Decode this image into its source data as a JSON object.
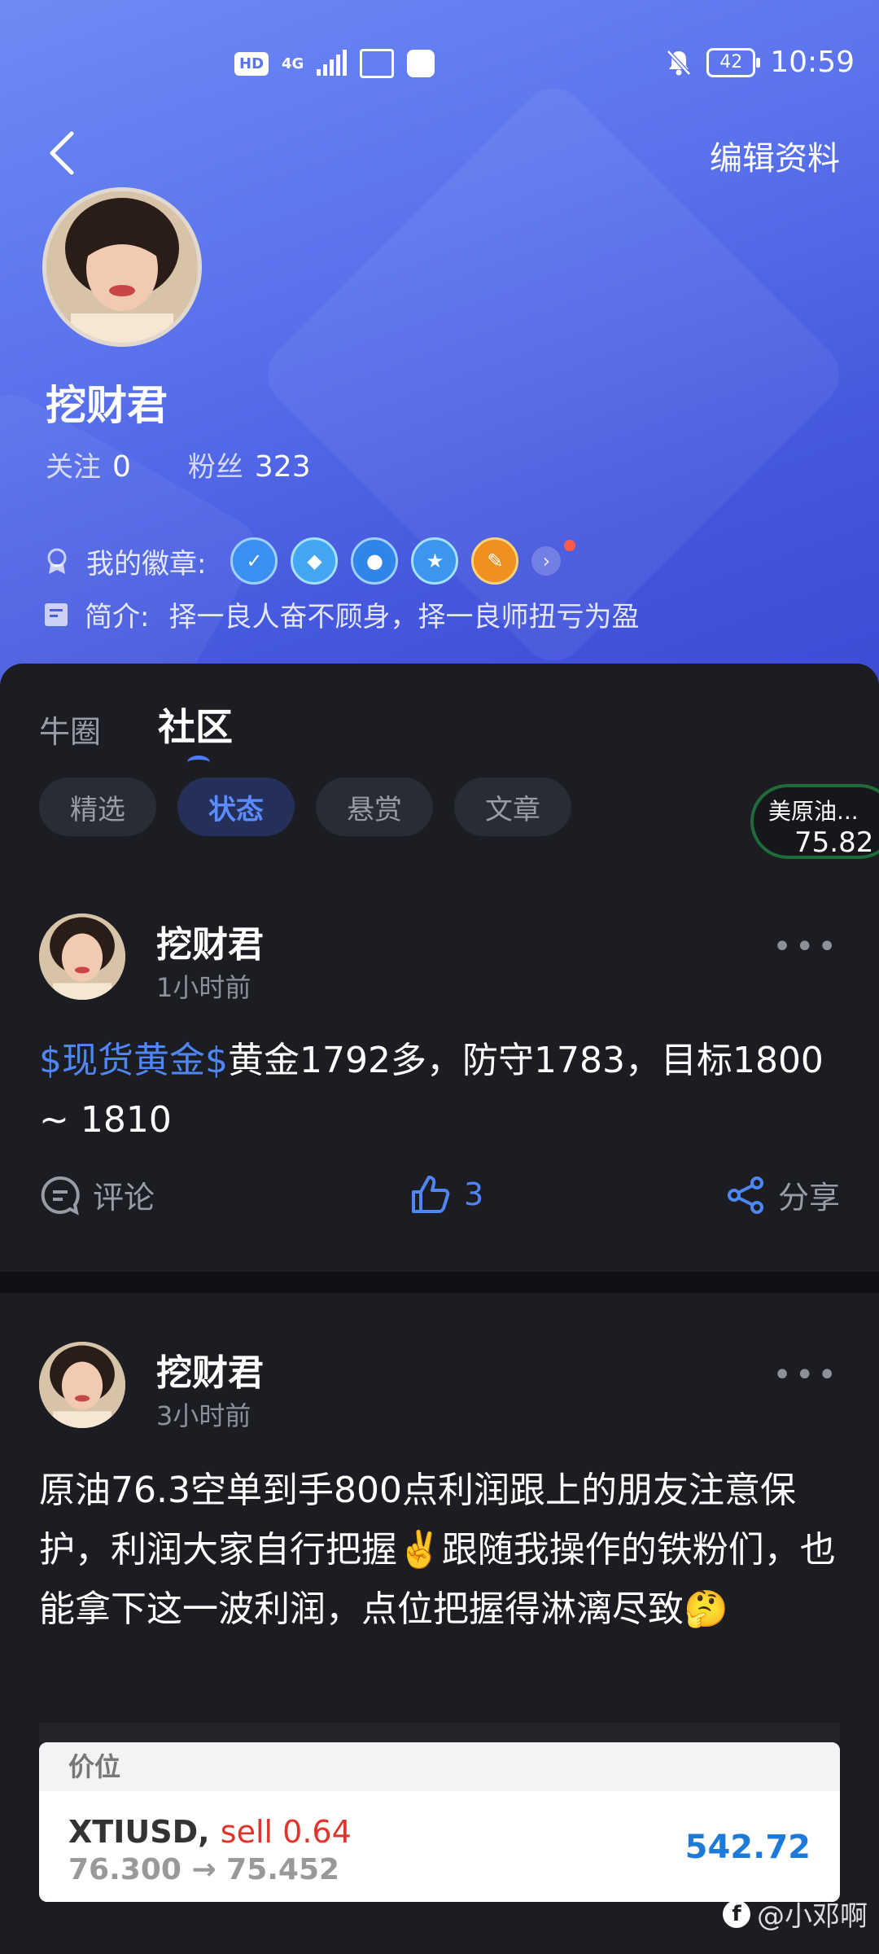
{
  "status_bar": {
    "time": "10:59",
    "battery": "42",
    "network": "4G",
    "hd": "HD"
  },
  "header": {
    "back_icon": "chevron-left-icon",
    "edit_label": "编辑资料"
  },
  "profile": {
    "name": "挖财君",
    "follow_label": "关注",
    "follow_count": "0",
    "fans_label": "粉丝",
    "fans_count": "323",
    "badges_label": "我的徽章:",
    "intro_label": "简介:",
    "intro_text": "择一良人奋不顾身，择一良师扭亏为盈"
  },
  "tabs": [
    {
      "label": "牛圈"
    },
    {
      "label": "社区"
    }
  ],
  "chips": [
    {
      "label": "精选"
    },
    {
      "label": "状态"
    },
    {
      "label": "悬赏"
    },
    {
      "label": "文章"
    }
  ],
  "ticker": {
    "name": "美原油...",
    "price": "75.82"
  },
  "posts": [
    {
      "author": "挖财君",
      "time": "1小时前",
      "tag": "$现货黄金$",
      "text": "黄金1792多，防守1783，目标1800 ~ 1810",
      "comment_label": "评论",
      "like_count": "3",
      "share_label": "分享"
    },
    {
      "author": "挖财君",
      "time": "3小时前",
      "text": "原油76.3空单到手800点利润跟上的朋友注意保护，利润大家自行把握✌️跟随我操作的铁粉们，也能拿下这一波利润，点位把握得淋漓尽致🤔",
      "card": {
        "header": "价位",
        "symbol": "XTIUSD,",
        "side": "sell 0.64",
        "range": "76.300 → 75.452",
        "profit": "542.72"
      }
    }
  ],
  "watermark": "@小邓啊"
}
